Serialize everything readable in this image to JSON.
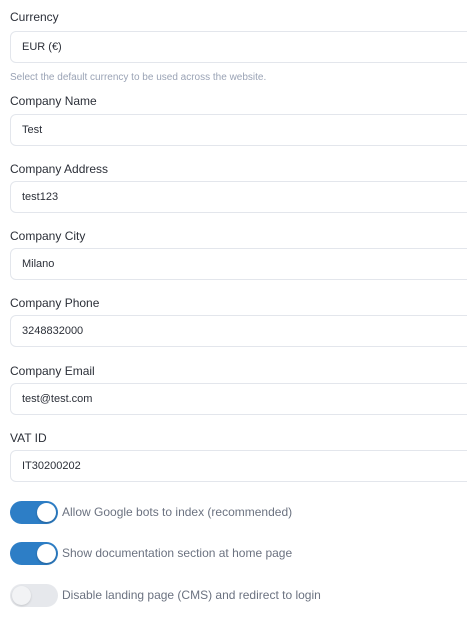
{
  "fields": {
    "currency": {
      "label": "Currency",
      "value": "EUR (€)",
      "help": "Select the default currency to be used across the website."
    },
    "company_name": {
      "label": "Company Name",
      "value": "Test"
    },
    "company_address": {
      "label": "Company Address",
      "value": "test123"
    },
    "company_city": {
      "label": "Company City",
      "value": "Milano"
    },
    "company_phone": {
      "label": "Company Phone",
      "value": "3248832000"
    },
    "company_email": {
      "label": "Company Email",
      "value": "test@test.com"
    },
    "vat_id": {
      "label": "VAT ID",
      "value": "IT30200202"
    }
  },
  "toggles": {
    "google_index": {
      "label": "Allow Google bots to index (recommended)",
      "state": "on"
    },
    "show_docs": {
      "label": "Show documentation section at home page",
      "state": "on"
    },
    "disable_landing": {
      "label": "Disable landing page (CMS) and redirect to login",
      "state": "off"
    }
  },
  "colors": {
    "toggle_on": "#2d7ec6",
    "toggle_off": "#e6e8ec",
    "help_text": "#9aa3b5",
    "input_border": "#e3e6ec"
  }
}
